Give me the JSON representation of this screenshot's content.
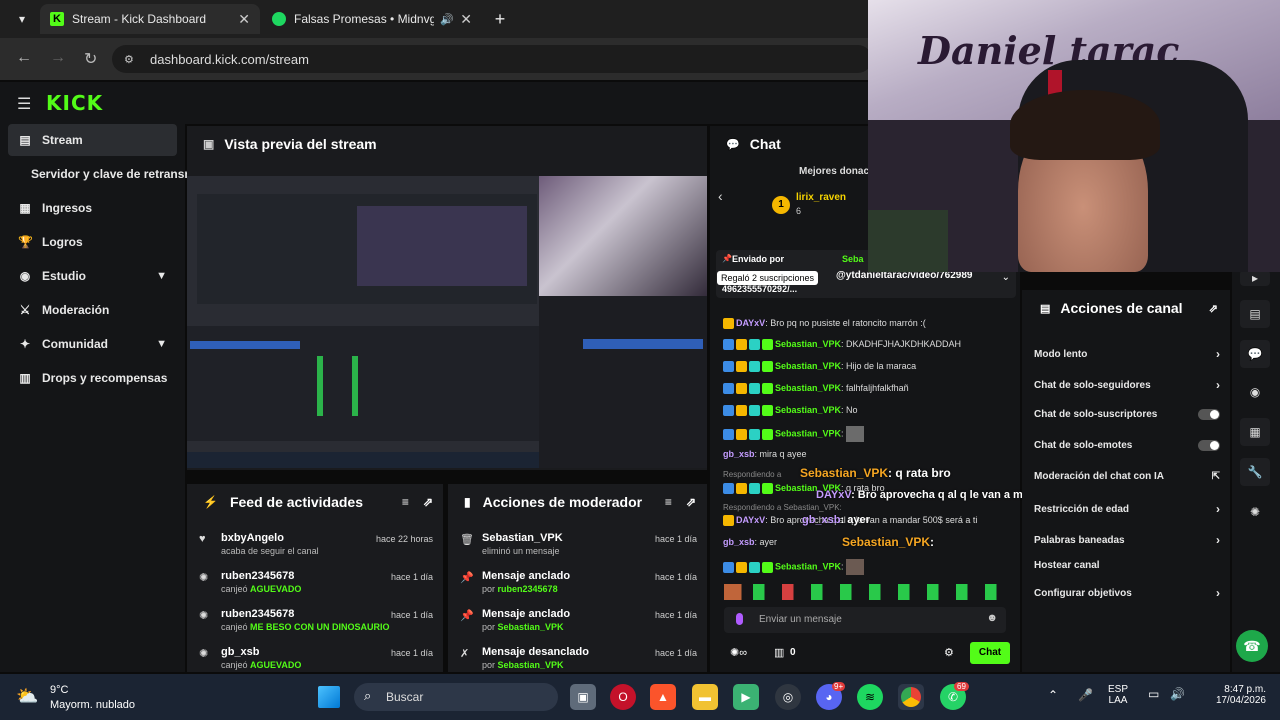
{
  "browser": {
    "tabs": [
      {
        "label": "Stream - Kick Dashboard"
      },
      {
        "label": "Falsas Promesas • Midnvght"
      }
    ],
    "url": "dashboard.kick.com/stream"
  },
  "sidebar": {
    "items": [
      {
        "label": "Stream"
      },
      {
        "label": "Servidor y clave de retransn"
      },
      {
        "label": "Ingresos"
      },
      {
        "label": "Logros"
      },
      {
        "label": "Estudio"
      },
      {
        "label": "Moderación"
      },
      {
        "label": "Comunidad"
      },
      {
        "label": "Drops y recompensas"
      }
    ]
  },
  "brand": {
    "logo": "KICK",
    "accent": "#53fc18"
  },
  "preview": {
    "title": "Vista previa del stream"
  },
  "activity": {
    "title": "Feed de actividades",
    "items": [
      {
        "name": "bxbyAngelo",
        "sub": "acaba de seguir el canal",
        "highlight": "",
        "time": "hace 22 horas"
      },
      {
        "name": "ruben2345678",
        "sub": "canjeó",
        "highlight": "AGUEVADO",
        "time": "hace 1 día"
      },
      {
        "name": "ruben2345678",
        "sub": "canjeó",
        "highlight": "ME BESO CON UN DINOSAURIO",
        "time": "hace 1 día"
      },
      {
        "name": "gb_xsb",
        "sub": "canjeó",
        "highlight": "AGUEVADO",
        "time": "hace 1 día"
      }
    ]
  },
  "modactions": {
    "title": "Acciones de moderador",
    "items": [
      {
        "name": "Sebastian_VPK",
        "sub": "eliminó un mensaje",
        "highlight": "",
        "time": "hace 1 día"
      },
      {
        "name": "Mensaje anclado",
        "sub": "por",
        "highlight": "ruben2345678",
        "time": "hace 1 día"
      },
      {
        "name": "Mensaje anclado",
        "sub": "por",
        "highlight": "Sebastian_VPK",
        "time": "hace 1 día"
      },
      {
        "name": "Mensaje desanclado",
        "sub": "por",
        "highlight": "Sebastian_VPK",
        "time": "hace 1 día"
      }
    ]
  },
  "chat": {
    "title": "Chat",
    "top_donors": "Mejores donac",
    "donor": {
      "rank": "1",
      "name": "lirix_raven",
      "count": "6"
    },
    "pinned_label": "Enviado por",
    "pinned_user": "Seba",
    "tooltip": "Regaló 2 suscripciones",
    "pinned_text": "@ytdanieltarac/video/762989",
    "pinned_text2": "4962355570292/...",
    "messages": [
      {
        "user": "DAYxV",
        "text": "Bro pq no pusiste el ratoncito marrón :(",
        "color": "#c49cff"
      },
      {
        "user": "Sebastian_VPK",
        "text": "DKADHFJHAJKDHKADDAH",
        "color": "#53fc18"
      },
      {
        "user": "Sebastian_VPK",
        "text": "Hijo de la maraca",
        "color": "#53fc18"
      },
      {
        "user": "Sebastian_VPK",
        "text": "falhfaljhfalkfhañ",
        "color": "#53fc18"
      },
      {
        "user": "Sebastian_VPK",
        "text": "No",
        "color": "#53fc18"
      },
      {
        "user": "Sebastian_VPK",
        "text": "",
        "color": "#53fc18"
      },
      {
        "user": "gb_xsb",
        "text": "mira q ayee",
        "color": "#c49cff"
      },
      {
        "user": "Sebastian_VPK",
        "text": "q rata bro",
        "color": "#53fc18"
      },
      {
        "user": "DAYxV",
        "text": "Bro aprovecha q al q le van a mandar 500$ será a ti",
        "color": "#c49cff"
      },
      {
        "user": "gb_xsb",
        "text": "ayer",
        "color": "#c49cff"
      },
      {
        "user": "Sebastian_VPK",
        "text": "",
        "color": "#53fc18"
      }
    ],
    "replying": "Respondiendo a",
    "replying_user_1": "Sebastian_VPK:",
    "overlay_1_user": "Sebastian_VPK",
    "overlay_1_text": ": q rata bro",
    "overlay_2_user": "DAYxV",
    "overlay_2_text": ": Bro aprovecha q al q le van a mandar 500$ será a ti",
    "overlay_3_user": "gb_xsb",
    "overlay_3_text": ": ayer",
    "overlay_4_user": "Sebastian_VPK",
    "overlay_4_text": ":",
    "input_placeholder": "Enviar un mensaje",
    "count": "0",
    "send_label": "Chat"
  },
  "channel_actions": {
    "title": "Acciones de canal",
    "items": [
      {
        "label": "Modo lento",
        "control": "chevron"
      },
      {
        "label": "Chat de solo-seguidores",
        "control": "chevron"
      },
      {
        "label": "Chat de solo-suscriptores",
        "control": "toggle"
      },
      {
        "label": "Chat de solo-emotes",
        "control": "toggle"
      },
      {
        "label": "Moderación del chat con IA",
        "control": "external"
      },
      {
        "label": "Restricción de edad",
        "control": "chevron"
      },
      {
        "label": "Palabras baneadas",
        "control": "chevron"
      },
      {
        "label": "Hostear canal",
        "control": "none"
      },
      {
        "label": "Configurar objetivos",
        "control": "chevron"
      }
    ]
  },
  "webcam": {
    "graffiti": "Daniel tarac"
  },
  "taskbar": {
    "weather_temp": "9°C",
    "weather_desc": "Mayorm. nublado",
    "search": "Buscar",
    "lang": "ESP",
    "lang2": "LAA",
    "time": "8:47 p.m.",
    "date": "17/04/2026",
    "whatsapp_badge": "69",
    "discord_badge": "9+"
  }
}
